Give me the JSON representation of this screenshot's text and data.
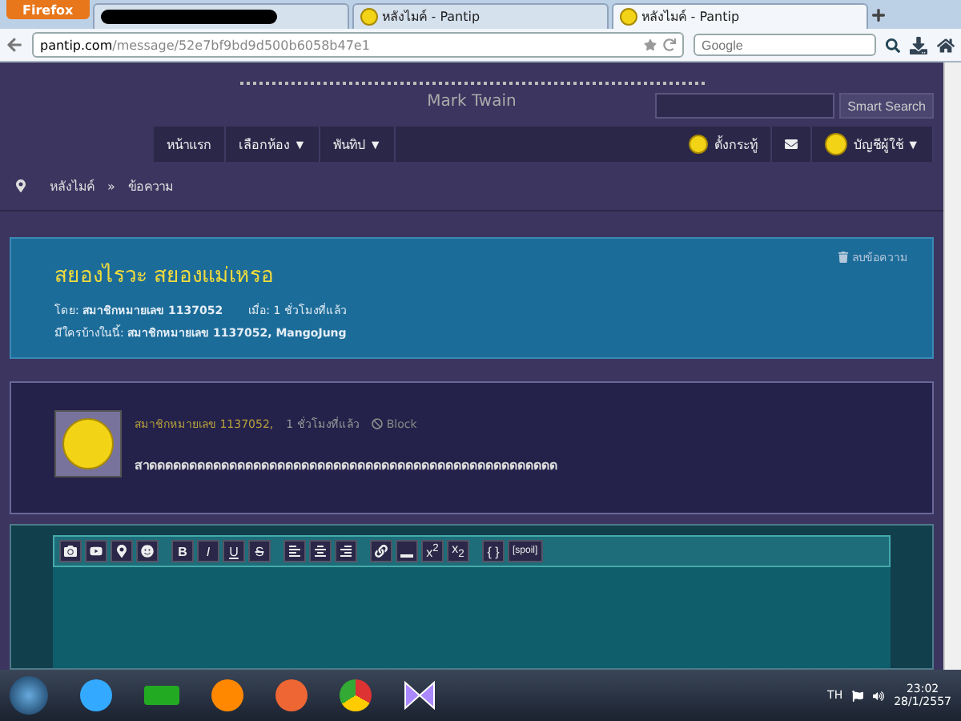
{
  "browser": {
    "menu_button": "Firefox",
    "tabs": [
      {
        "redacted": true,
        "selected": false
      },
      {
        "label": "หลังไมค์ - Pantip",
        "redacted": false,
        "selected": false
      },
      {
        "label": "หลังไมค์ - Pantip",
        "redacted": false,
        "selected": true
      }
    ],
    "address": {
      "domain": "pantip.com",
      "path": "/message/52e7bf9bd9d500b6058b47e1"
    },
    "search": {
      "placeholder": "Google"
    }
  },
  "header": {
    "quote_author": "Mark Twain",
    "search_button": "Smart Search",
    "nav_left": [
      "หน้าแรก",
      "เลือกห้อง ▼",
      "พันทิป ▼"
    ],
    "new_topic": "ตั้งกระทู้",
    "account": "บัญชีผู้ใช้ ▼"
  },
  "breadcrumb": {
    "items": [
      "หลังไมค์",
      "ข้อความ"
    ],
    "separator": "»"
  },
  "topic": {
    "delete_link": "ลบข้อความ",
    "title": "สยองไรวะ สยองแม่เหรอ",
    "by": "โดย: **สมาชิกหมายเลข 1137052**",
    "when": "เมื่อ: 1 ชั่วโมงที่แล้ว",
    "participants": "มีใครบ้างในนี้: **สมาชิกหมายเลข 1137052, MangoJung**"
  },
  "post": {
    "author": "สมาชิกหมายเลข 1137052,",
    "time": "1 ชั่วโมงที่แล้ว",
    "block": "Block",
    "body": "สาดดดดดดดดดดดดดดดดดดดดดดดดดดดดดดดดดดดดดดดดดดดดดดดดดดด"
  },
  "editor": {
    "format_buttons": [
      "B",
      "I",
      "U",
      "S"
    ],
    "script_buttons": [
      "x$^{2}$",
      "x$_{2}$"
    ],
    "code_button": "{ }",
    "spoil_button": "[spoil]"
  },
  "taskbar": {
    "language": "TH",
    "time": "23:02",
    "date": "28/1/2557"
  }
}
